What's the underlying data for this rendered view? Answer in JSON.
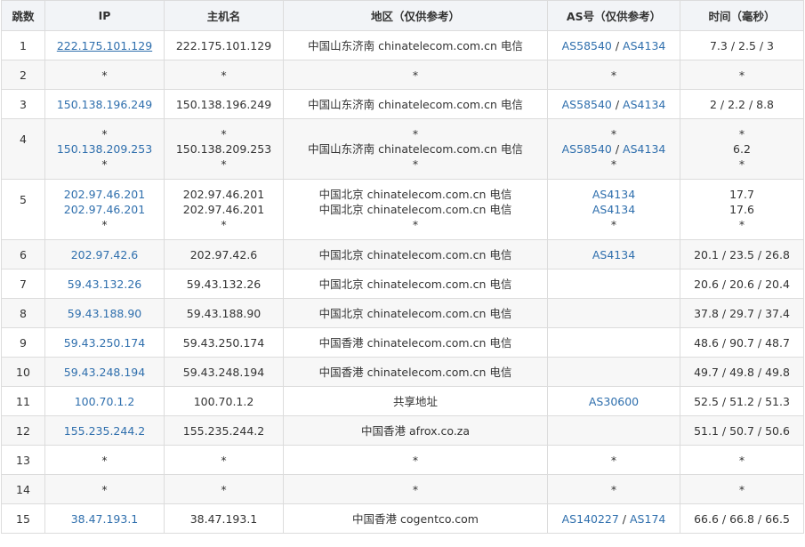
{
  "headers": {
    "hop": "跳数",
    "ip": "IP",
    "host": "主机名",
    "region": "地区（仅供参考）",
    "as": "AS号（仅供参考）",
    "time": "时间（毫秒）"
  },
  "rows": [
    {
      "hop": "1",
      "ip": [
        "222.175.101.129"
      ],
      "host": [
        "222.175.101.129"
      ],
      "region": [
        "中国山东济南 chinatelecom.com.cn 电信"
      ],
      "as": [
        [
          "AS58540",
          "AS4134"
        ]
      ],
      "time": [
        "7.3 / 2.5 / 3"
      ]
    },
    {
      "hop": "2",
      "ip": [
        "*"
      ],
      "host": [
        "*"
      ],
      "region": [
        "*"
      ],
      "as": [
        [
          "*"
        ]
      ],
      "time": [
        "*"
      ]
    },
    {
      "hop": "3",
      "ip": [
        "150.138.196.249"
      ],
      "host": [
        "150.138.196.249"
      ],
      "region": [
        "中国山东济南 chinatelecom.com.cn 电信"
      ],
      "as": [
        [
          "AS58540",
          "AS4134"
        ]
      ],
      "time": [
        "2 / 2.2 / 8.8"
      ]
    },
    {
      "hop": "4",
      "ip": [
        "*",
        "150.138.209.253",
        "*"
      ],
      "host": [
        "*",
        "150.138.209.253",
        "*"
      ],
      "region": [
        "*",
        "中国山东济南 chinatelecom.com.cn 电信",
        "*"
      ],
      "as": [
        [
          "*"
        ],
        [
          "AS58540",
          "AS4134"
        ],
        [
          "*"
        ]
      ],
      "time": [
        "*",
        "6.2",
        "*"
      ]
    },
    {
      "hop": "5",
      "ip": [
        "202.97.46.201",
        "202.97.46.201",
        "*"
      ],
      "host": [
        "202.97.46.201",
        "202.97.46.201",
        "*"
      ],
      "region": [
        "中国北京 chinatelecom.com.cn 电信",
        "中国北京 chinatelecom.com.cn 电信",
        "*"
      ],
      "as": [
        [
          "AS4134"
        ],
        [
          "AS4134"
        ],
        [
          "*"
        ]
      ],
      "time": [
        "17.7",
        "17.6",
        "*"
      ]
    },
    {
      "hop": "6",
      "ip": [
        "202.97.42.6"
      ],
      "host": [
        "202.97.42.6"
      ],
      "region": [
        "中国北京 chinatelecom.com.cn 电信"
      ],
      "as": [
        [
          "AS4134"
        ]
      ],
      "time": [
        "20.1 / 23.5 / 26.8"
      ]
    },
    {
      "hop": "7",
      "ip": [
        "59.43.132.26"
      ],
      "host": [
        "59.43.132.26"
      ],
      "region": [
        "中国北京 chinatelecom.com.cn 电信"
      ],
      "as": [
        []
      ],
      "time": [
        "20.6 / 20.6 / 20.4"
      ]
    },
    {
      "hop": "8",
      "ip": [
        "59.43.188.90"
      ],
      "host": [
        "59.43.188.90"
      ],
      "region": [
        "中国北京 chinatelecom.com.cn 电信"
      ],
      "as": [
        []
      ],
      "time": [
        "37.8 / 29.7 / 37.4"
      ]
    },
    {
      "hop": "9",
      "ip": [
        "59.43.250.174"
      ],
      "host": [
        "59.43.250.174"
      ],
      "region": [
        "中国香港 chinatelecom.com.cn 电信"
      ],
      "as": [
        []
      ],
      "time": [
        "48.6 / 90.7 / 48.7"
      ]
    },
    {
      "hop": "10",
      "ip": [
        "59.43.248.194"
      ],
      "host": [
        "59.43.248.194"
      ],
      "region": [
        "中国香港 chinatelecom.com.cn 电信"
      ],
      "as": [
        []
      ],
      "time": [
        "49.7 / 49.8 / 49.8"
      ]
    },
    {
      "hop": "11",
      "ip": [
        "100.70.1.2"
      ],
      "host": [
        "100.70.1.2"
      ],
      "region": [
        "共享地址"
      ],
      "as": [
        [
          "AS30600"
        ]
      ],
      "time": [
        "52.5 / 51.2 / 51.3"
      ]
    },
    {
      "hop": "12",
      "ip": [
        "155.235.244.2"
      ],
      "host": [
        "155.235.244.2"
      ],
      "region": [
        "中国香港 afrox.co.za"
      ],
      "as": [
        []
      ],
      "time": [
        "51.1 / 50.7 / 50.6"
      ]
    },
    {
      "hop": "13",
      "ip": [
        "*"
      ],
      "host": [
        "*"
      ],
      "region": [
        "*"
      ],
      "as": [
        [
          "*"
        ]
      ],
      "time": [
        "*"
      ]
    },
    {
      "hop": "14",
      "ip": [
        "*"
      ],
      "host": [
        "*"
      ],
      "region": [
        "*"
      ],
      "as": [
        [
          "*"
        ]
      ],
      "time": [
        "*"
      ]
    },
    {
      "hop": "15",
      "ip": [
        "38.47.193.1"
      ],
      "host": [
        "38.47.193.1"
      ],
      "region": [
        "中国香港 cogentco.com"
      ],
      "as": [
        [
          "AS140227",
          "AS174"
        ]
      ],
      "time": [
        "66.6 / 66.8 / 66.5"
      ]
    }
  ],
  "colors": {
    "link": "#2f6fad",
    "header_bg": "#f2f4f7",
    "stripe": "#f7f7f7",
    "border": "#dcdcdc"
  }
}
